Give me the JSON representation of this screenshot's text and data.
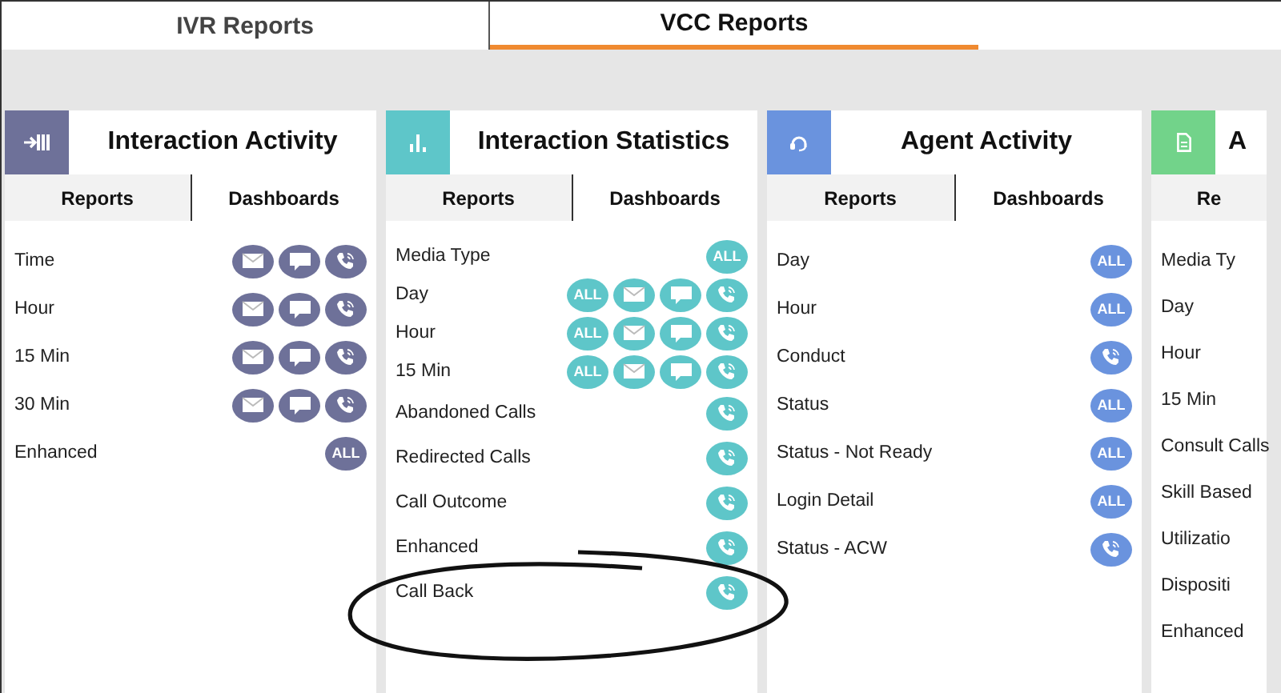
{
  "top_tabs": [
    {
      "label": "IVR Reports",
      "selected": false
    },
    {
      "label": "VCC Reports",
      "selected": true
    }
  ],
  "cards": [
    {
      "title": "Interaction Activity",
      "color": "#6e7199",
      "tabs": [
        {
          "label": "Reports",
          "selected": true
        },
        {
          "label": "Dashboards",
          "selected": false
        }
      ],
      "rows": [
        {
          "label": "Time",
          "buttons": [
            {
              "kind": "email"
            },
            {
              "kind": "chat"
            },
            {
              "kind": "phone"
            }
          ]
        },
        {
          "label": "Hour",
          "buttons": [
            {
              "kind": "email"
            },
            {
              "kind": "chat"
            },
            {
              "kind": "phone"
            }
          ]
        },
        {
          "label": "15 Min",
          "buttons": [
            {
              "kind": "email"
            },
            {
              "kind": "chat"
            },
            {
              "kind": "phone"
            }
          ]
        },
        {
          "label": "30 Min",
          "buttons": [
            {
              "kind": "email"
            },
            {
              "kind": "chat"
            },
            {
              "kind": "phone"
            }
          ]
        },
        {
          "label": "Enhanced",
          "buttons": [
            {
              "kind": "all",
              "label": "ALL"
            }
          ]
        }
      ]
    },
    {
      "title": "Interaction Statistics",
      "color": "#5ec6c9",
      "tabs": [
        {
          "label": "Reports",
          "selected": true
        },
        {
          "label": "Dashboards",
          "selected": false
        }
      ],
      "rows": [
        {
          "label": "Media Type",
          "buttons": [
            {
              "kind": "all",
              "label": "ALL"
            }
          ]
        },
        {
          "label": "Day",
          "buttons": [
            {
              "kind": "all",
              "label": "ALL"
            },
            {
              "kind": "email"
            },
            {
              "kind": "chat"
            },
            {
              "kind": "phone"
            }
          ]
        },
        {
          "label": "Hour",
          "buttons": [
            {
              "kind": "all",
              "label": "ALL"
            },
            {
              "kind": "email"
            },
            {
              "kind": "chat"
            },
            {
              "kind": "phone"
            }
          ]
        },
        {
          "label": "15 Min",
          "buttons": [
            {
              "kind": "all",
              "label": "ALL"
            },
            {
              "kind": "email"
            },
            {
              "kind": "chat"
            },
            {
              "kind": "phone"
            }
          ]
        },
        {
          "label": "Abandoned Calls",
          "buttons": [
            {
              "kind": "phone"
            }
          ]
        },
        {
          "label": "Redirected Calls",
          "buttons": [
            {
              "kind": "phone"
            }
          ]
        },
        {
          "label": "Call Outcome",
          "buttons": [
            {
              "kind": "phone"
            }
          ]
        },
        {
          "label": "Enhanced",
          "buttons": [
            {
              "kind": "phone"
            }
          ]
        },
        {
          "label": "Call Back",
          "buttons": [
            {
              "kind": "phone"
            }
          ]
        }
      ]
    },
    {
      "title": "Agent Activity",
      "color": "#6a93de",
      "tabs": [
        {
          "label": "Reports",
          "selected": true
        },
        {
          "label": "Dashboards",
          "selected": false
        }
      ],
      "rows": [
        {
          "label": "Day",
          "buttons": [
            {
              "kind": "all",
              "label": "ALL"
            }
          ]
        },
        {
          "label": "Hour",
          "buttons": [
            {
              "kind": "all",
              "label": "ALL"
            }
          ]
        },
        {
          "label": "Conduct",
          "buttons": [
            {
              "kind": "phone"
            }
          ]
        },
        {
          "label": "Status",
          "buttons": [
            {
              "kind": "all",
              "label": "ALL"
            }
          ]
        },
        {
          "label": "Status - Not Ready",
          "buttons": [
            {
              "kind": "all",
              "label": "ALL"
            }
          ]
        },
        {
          "label": "Login Detail",
          "buttons": [
            {
              "kind": "all",
              "label": "ALL"
            }
          ]
        },
        {
          "label": "Status - ACW",
          "buttons": [
            {
              "kind": "phone"
            }
          ]
        }
      ]
    },
    {
      "title": "A",
      "color": "#72d38a",
      "tabs": [
        {
          "label": "Re",
          "selected": true
        }
      ],
      "rows": [
        {
          "label": "Media Ty",
          "buttons": []
        },
        {
          "label": "Day",
          "buttons": []
        },
        {
          "label": "Hour",
          "buttons": []
        },
        {
          "label": "15 Min",
          "buttons": []
        },
        {
          "label": "Consult Calls",
          "buttons": []
        },
        {
          "label": "Skill Based",
          "buttons": []
        },
        {
          "label": "Utilizatio",
          "buttons": []
        },
        {
          "label": "Dispositi",
          "buttons": []
        },
        {
          "label": "Enhanced",
          "buttons": []
        }
      ]
    }
  ]
}
